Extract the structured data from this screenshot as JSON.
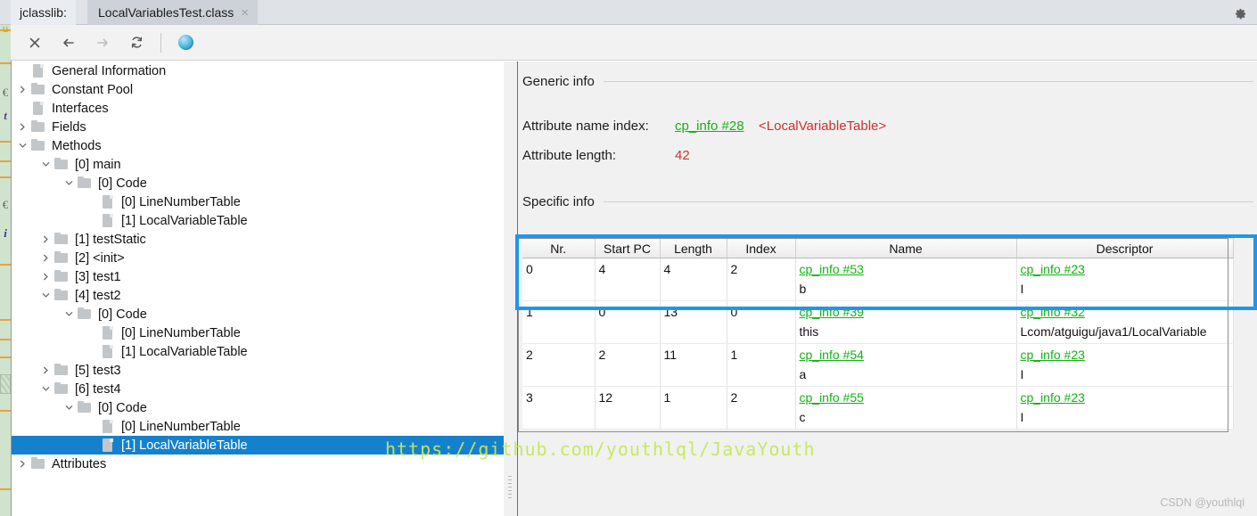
{
  "window": {
    "tab_prefix": "jclasslib:",
    "active_tab": "LocalVariablesTest.class",
    "close_glyph": "×",
    "settings_icon": "gear-icon"
  },
  "toolbar": {
    "buttons": [
      {
        "name": "close-icon",
        "glyph": "×",
        "enabled": true
      },
      {
        "name": "back-arrow-icon",
        "glyph": "←",
        "enabled": true
      },
      {
        "name": "forward-arrow-icon",
        "glyph": "→",
        "enabled": false
      },
      {
        "name": "reload-icon",
        "glyph": "↻",
        "enabled": true
      },
      {
        "name": "browser-globe-icon",
        "glyph": "●",
        "enabled": true
      }
    ]
  },
  "tree": {
    "items": [
      {
        "label": "General Information",
        "indent": 1,
        "twisty": "none",
        "icon": "file"
      },
      {
        "label": "Constant Pool",
        "indent": 1,
        "twisty": "collapsed",
        "icon": "folder"
      },
      {
        "label": "Interfaces",
        "indent": 1,
        "twisty": "none",
        "icon": "file"
      },
      {
        "label": "Fields",
        "indent": 1,
        "twisty": "collapsed",
        "icon": "folder"
      },
      {
        "label": "Methods",
        "indent": 1,
        "twisty": "expanded",
        "icon": "folder"
      },
      {
        "label": "[0] main",
        "indent": 2,
        "twisty": "expanded",
        "icon": "folder"
      },
      {
        "label": "[0] Code",
        "indent": 3,
        "twisty": "expanded",
        "icon": "folder"
      },
      {
        "label": "[0] LineNumberTable",
        "indent": 4,
        "twisty": "none",
        "icon": "file"
      },
      {
        "label": "[1] LocalVariableTable",
        "indent": 4,
        "twisty": "none",
        "icon": "file"
      },
      {
        "label": "[1] testStatic",
        "indent": 2,
        "twisty": "collapsed",
        "icon": "folder"
      },
      {
        "label": "[2] <init>",
        "indent": 2,
        "twisty": "collapsed",
        "icon": "folder"
      },
      {
        "label": "[3] test1",
        "indent": 2,
        "twisty": "collapsed",
        "icon": "folder"
      },
      {
        "label": "[4] test2",
        "indent": 2,
        "twisty": "expanded",
        "icon": "folder"
      },
      {
        "label": "[0] Code",
        "indent": 3,
        "twisty": "expanded",
        "icon": "folder"
      },
      {
        "label": "[0] LineNumberTable",
        "indent": 4,
        "twisty": "none",
        "icon": "file"
      },
      {
        "label": "[1] LocalVariableTable",
        "indent": 4,
        "twisty": "none",
        "icon": "file"
      },
      {
        "label": "[5] test3",
        "indent": 2,
        "twisty": "collapsed",
        "icon": "folder"
      },
      {
        "label": "[6] test4",
        "indent": 2,
        "twisty": "expanded",
        "icon": "folder"
      },
      {
        "label": "[0] Code",
        "indent": 3,
        "twisty": "expanded",
        "icon": "folder"
      },
      {
        "label": "[0] LineNumberTable",
        "indent": 4,
        "twisty": "none",
        "icon": "file"
      },
      {
        "label": "[1] LocalVariableTable",
        "indent": 4,
        "twisty": "none",
        "icon": "file",
        "selected": true
      },
      {
        "label": "Attributes",
        "indent": 1,
        "twisty": "collapsed",
        "icon": "folder"
      }
    ]
  },
  "detail": {
    "generic_info_heading": "Generic info",
    "specific_info_heading": "Specific info",
    "attribute_name_index_label": "Attribute name index:",
    "attribute_name_index_link": "cp_info #28",
    "attribute_name_index_value": "<LocalVariableTable>",
    "attribute_length_label": "Attribute length:",
    "attribute_length_value": "42"
  },
  "table": {
    "columns": [
      "Nr.",
      "Start PC",
      "Length",
      "Index",
      "Name",
      "Descriptor"
    ],
    "rows": [
      {
        "nr": "0",
        "start_pc": "4",
        "length": "4",
        "index": "2",
        "name_link": "cp_info #53",
        "name_value": "b",
        "desc_link": "cp_info #23",
        "desc_value": "I"
      },
      {
        "nr": "1",
        "start_pc": "0",
        "length": "13",
        "index": "0",
        "name_link": "cp_info #39",
        "name_value": "this",
        "desc_link": "cp_info #32",
        "desc_value": "Lcom/atguigu/java1/LocalVariable"
      },
      {
        "nr": "2",
        "start_pc": "2",
        "length": "11",
        "index": "1",
        "name_link": "cp_info #54",
        "name_value": "a",
        "desc_link": "cp_info #23",
        "desc_value": "I"
      },
      {
        "nr": "3",
        "start_pc": "12",
        "length": "1",
        "index": "2",
        "name_link": "cp_info #55",
        "name_value": "c",
        "desc_link": "cp_info #23",
        "desc_value": "I"
      }
    ]
  },
  "watermarks": {
    "url": "https://github.com/youthlql/JavaYouth",
    "csdn": "CSDN @youthlql"
  },
  "colors": {
    "link_green": "#12b312",
    "value_red": "#d0312d",
    "selection_blue": "#1581cd",
    "annotation_blue": "#2196e8",
    "watermark_green": "#c4e85c"
  }
}
